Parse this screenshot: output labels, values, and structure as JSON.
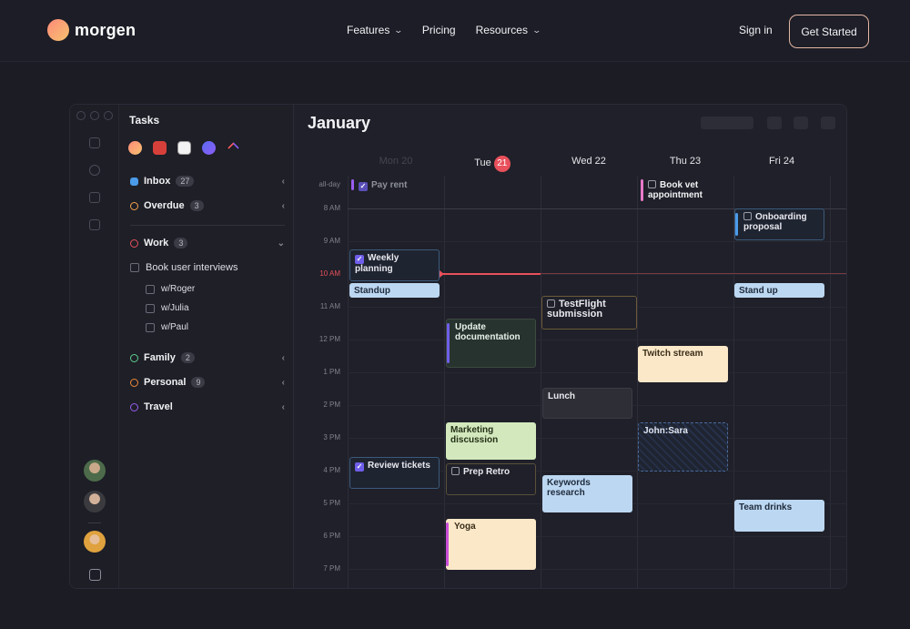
{
  "brand": {
    "name": "morgen"
  },
  "nav": {
    "links": [
      {
        "label": "Features",
        "has_dropdown": true
      },
      {
        "label": "Pricing",
        "has_dropdown": false
      },
      {
        "label": "Resources",
        "has_dropdown": true
      }
    ],
    "signin": "Sign in",
    "cta": "Get Started"
  },
  "tasks": {
    "title": "Tasks",
    "integrations": [
      "morgen-icon",
      "todoist-icon",
      "notion-icon",
      "linear-icon",
      "clickup-icon"
    ],
    "lists": {
      "inbox": {
        "label": "Inbox",
        "count": "27"
      },
      "overdue": {
        "label": "Overdue",
        "count": "3"
      },
      "work": {
        "label": "Work",
        "count": "3"
      },
      "book": {
        "label": "Book user interviews"
      },
      "sub": [
        "w/Roger",
        "w/Julia",
        "w/Paul"
      ],
      "family": {
        "label": "Family",
        "count": "2"
      },
      "personal": {
        "label": "Personal",
        "count": "9"
      },
      "travel": {
        "label": "Travel"
      }
    }
  },
  "calendar": {
    "month": "January",
    "days": {
      "mon": "Mon 20",
      "tue": "Tue",
      "tue_num": "21",
      "wed": "Wed 22",
      "thu": "Thu 23",
      "fri": "Fri 24"
    },
    "allday_label": "all-day",
    "times": [
      "8 AM",
      "9 AM",
      "10 AM",
      "11 AM",
      "12 PM",
      "1 PM",
      "2 PM",
      "3 PM",
      "4 PM",
      "5 PM",
      "6 PM",
      "7 PM"
    ],
    "events": {
      "payrent": "Pay rent",
      "bookvet": "Book vet appointment",
      "weekly": "Weekly planning",
      "standup": "Standup",
      "standup2": "Stand up",
      "onboarding": "Onboarding proposal",
      "testflight": "TestFlight submission",
      "update": "Update documentation",
      "twitch": "Twitch stream",
      "lunch": "Lunch",
      "marketing": "Marketing discussion",
      "johnsara": "John:Sara",
      "review": "Review tickets",
      "prep": "Prep Retro",
      "keywords": "Keywords research",
      "drinks": "Team drinks",
      "yoga": "Yoga"
    }
  },
  "colors": {
    "accent": "#e8505b",
    "checkbox": "#6f5ee9",
    "yellow": "#fbe8c8",
    "blue": "#bcd7f2",
    "green": "#d3e9bd",
    "dark_green": "#26332e"
  }
}
